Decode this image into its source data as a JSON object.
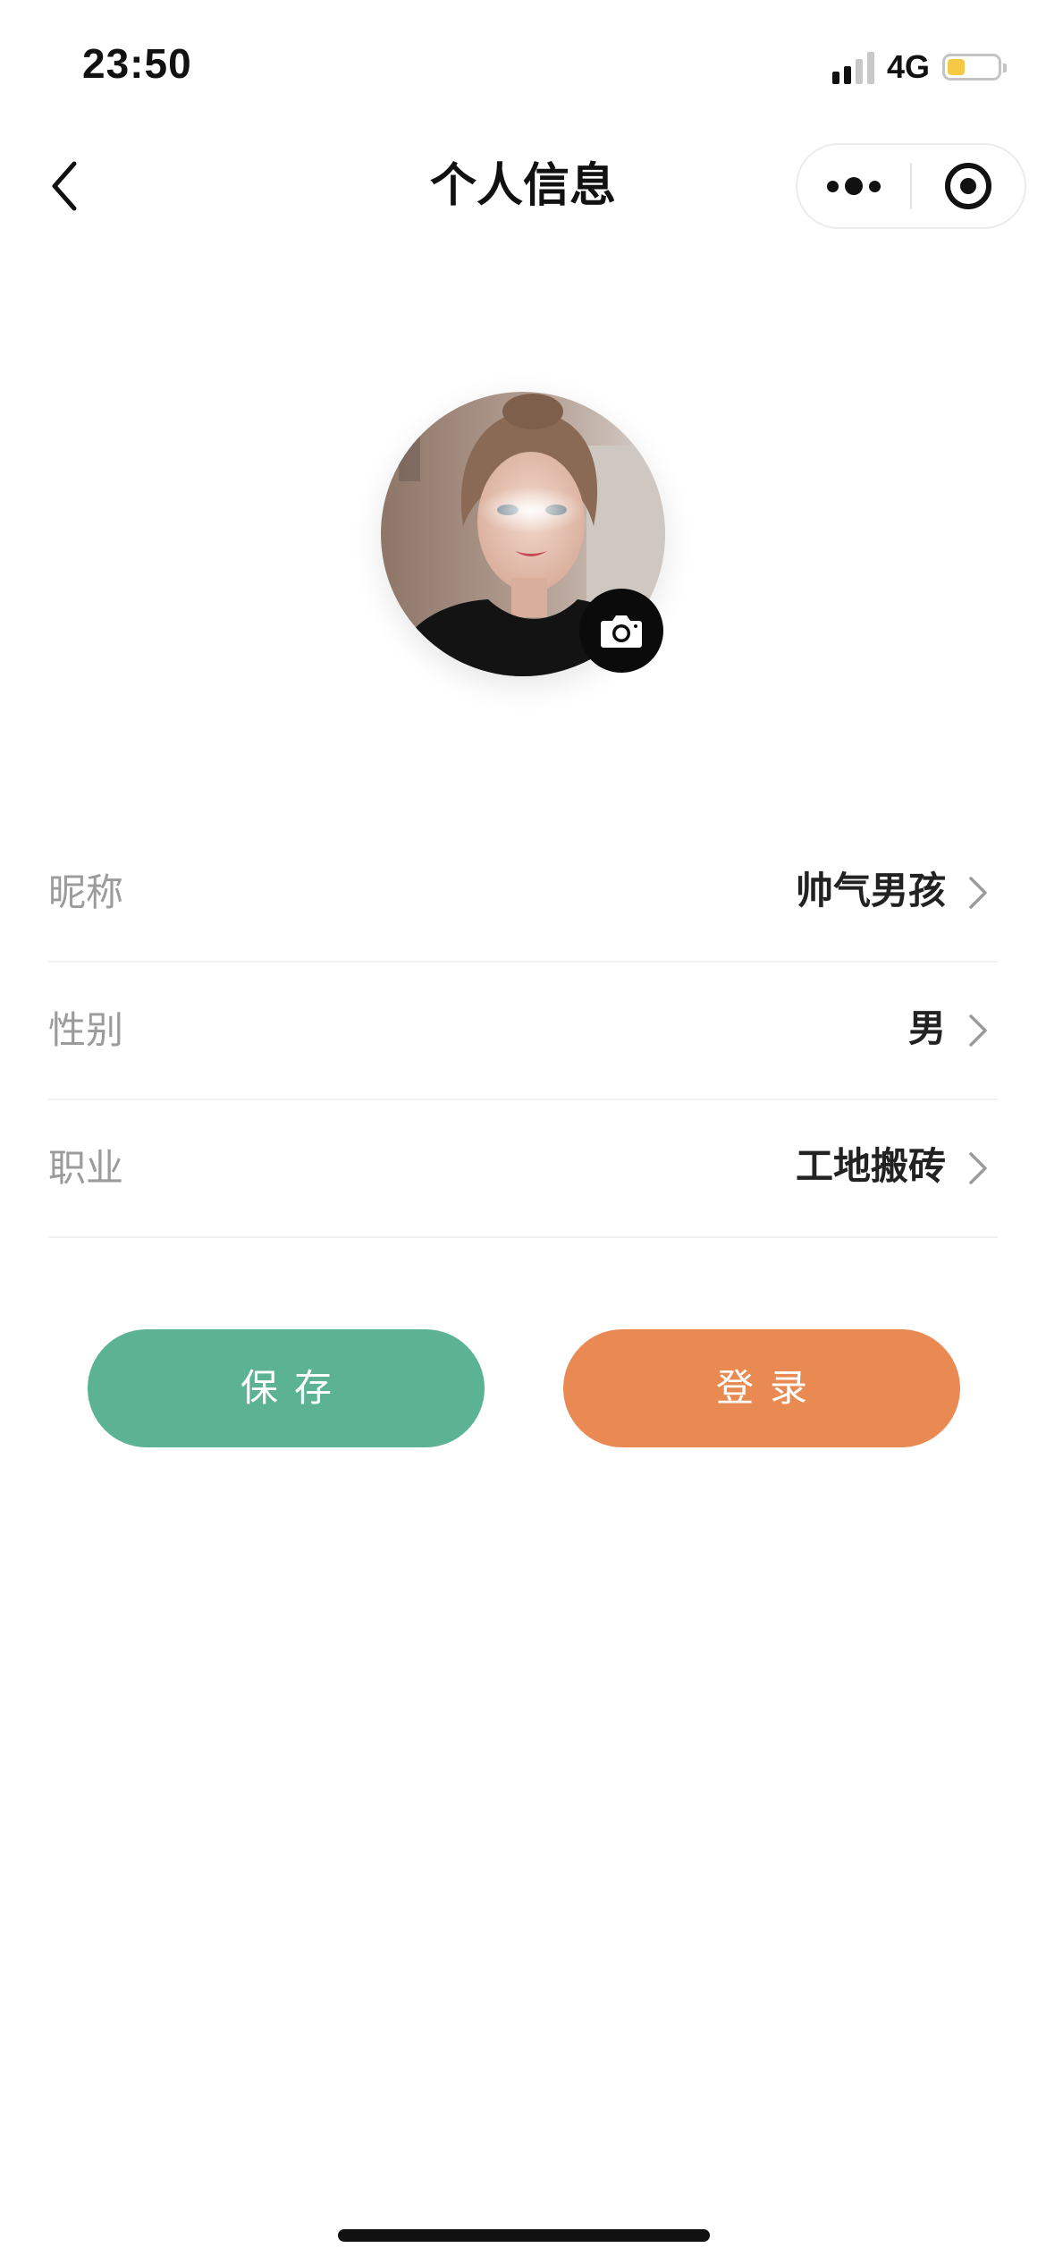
{
  "status_bar": {
    "time": "23:50",
    "network": "4G",
    "battery_level": 0.35,
    "battery_color": "#f6c945"
  },
  "nav": {
    "title": "个人信息",
    "back_icon": "chevron-left-icon",
    "more_icon": "more-dots-icon",
    "close_icon": "target-icon"
  },
  "profile": {
    "avatar_icon": "avatar-photo",
    "camera_icon": "camera-icon"
  },
  "fields": [
    {
      "label": "昵称",
      "value": "帅气男孩"
    },
    {
      "label": "性别",
      "value": "男"
    },
    {
      "label": "职业",
      "value": "工地搬砖"
    }
  ],
  "actions": {
    "save_label": "保存",
    "login_label": "登录",
    "save_color": "#5cb393",
    "login_color": "#e98a52"
  }
}
